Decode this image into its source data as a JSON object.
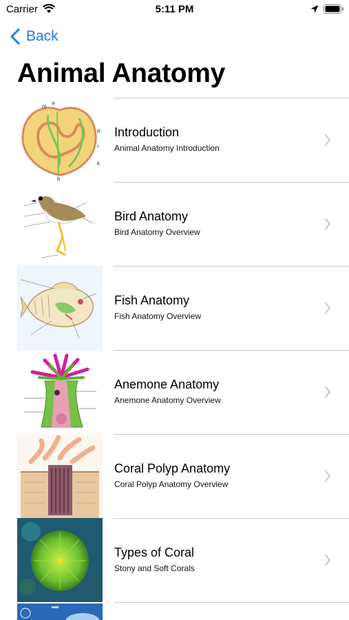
{
  "status_bar": {
    "carrier": "Carrier",
    "time": "5:11 PM"
  },
  "nav": {
    "back_label": "Back",
    "title": "Animal Anatomy"
  },
  "items": [
    {
      "title": "Introduction",
      "subtitle": "Animal Anatomy Introduction",
      "icon": "heart-anatomy-diagram"
    },
    {
      "title": "Bird Anatomy",
      "subtitle": "Bird Anatomy Overview",
      "icon": "bird-diagram"
    },
    {
      "title": "Fish Anatomy",
      "subtitle": "Fish Anatomy Overview",
      "icon": "fish-diagram"
    },
    {
      "title": "Anemone Anatomy",
      "subtitle": "Anemone Anatomy Overview",
      "icon": "anemone-diagram"
    },
    {
      "title": "Coral Polyp Anatomy",
      "subtitle": "Coral Polyp Anatomy Overview",
      "icon": "coral-polyp-diagram"
    },
    {
      "title": "Types of Coral",
      "subtitle": "Stony and Soft Corals",
      "icon": "coral-photo"
    }
  ],
  "colors": {
    "accent": "#1f7ae6",
    "separator": "#c9c9cc",
    "chevron": "#c4c4c7"
  }
}
